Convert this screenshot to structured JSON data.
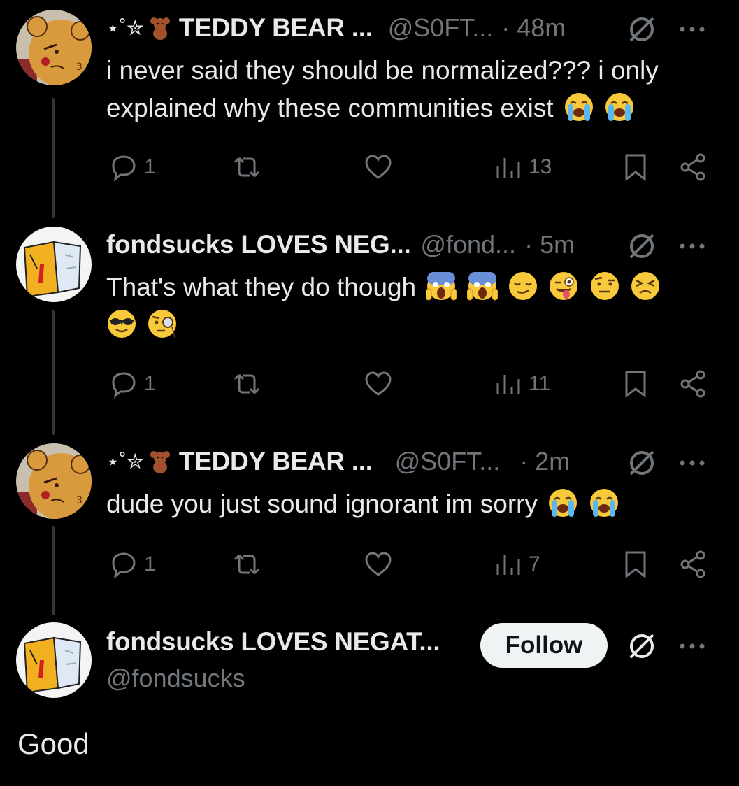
{
  "tweets": [
    {
      "deco": "⋆˚✮",
      "display_name": "TEDDY BEAR ...",
      "handle": "@S0FT...",
      "time": "48m",
      "text": "i never said they should be normalized??? i only explained why these communities exist",
      "emojis": [
        "loudly-crying",
        "loudly-crying"
      ],
      "replies": "1",
      "views": "13",
      "avatar": "teddy-bear-cookie"
    },
    {
      "deco": "",
      "display_name": "fondsucks LOVES NEG...",
      "handle": "@fond...",
      "time": "5m",
      "text": "That's what they do though",
      "emojis": [
        "screaming",
        "screaming",
        "relieved",
        "winking-tongue",
        "raised-eyebrow",
        "persevering",
        "sunglasses",
        "monocle"
      ],
      "replies": "1",
      "views": "11",
      "avatar": "fondsucks-drawing"
    },
    {
      "deco": "⋆˚✮",
      "display_name": "TEDDY BEAR ...",
      "handle": "@S0FT...",
      "time": "2m",
      "text": "dude you just sound ignorant im sorry",
      "emojis": [
        "loudly-crying",
        "loudly-crying"
      ],
      "replies": "1",
      "views": "7",
      "avatar": "teddy-bear-cookie"
    }
  ],
  "main_tweet": {
    "display_name": "fondsucks LOVES NEGAT...",
    "handle": "@fondsucks",
    "follow_label": "Follow",
    "text": "Good"
  },
  "separator": "·",
  "colors": {
    "background": "#000000",
    "text": "#e7e9ea",
    "muted": "#71767b",
    "thread_line": "#333639",
    "follow_bg": "#eff3f4"
  }
}
